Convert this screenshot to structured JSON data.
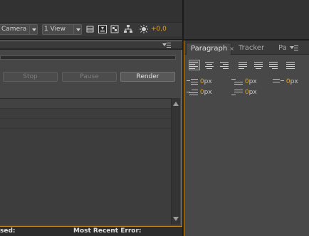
{
  "viewer_toolbar": {
    "view_dropdown": "Camera",
    "views_dropdown": "1 View",
    "exposure_value": "+0,0",
    "icons": [
      "grid-icon",
      "snapshot-icon",
      "transparency-grid-icon",
      "flowchart-icon",
      "exposure-icon"
    ]
  },
  "render_queue": {
    "buttons": {
      "stop": "Stop",
      "pause": "Pause",
      "render": "Render"
    },
    "status_bar": {
      "elapsed_label": "sed:",
      "error_label": "Most Recent Error:"
    }
  },
  "paragraph_panel": {
    "tabs": [
      {
        "label": "Paragraph",
        "close": "×"
      },
      {
        "label": "Tracker"
      },
      {
        "label": "Pa"
      }
    ],
    "alignment_icons": [
      "align-left-icon",
      "align-center-icon",
      "align-right-icon",
      "justify-left-icon",
      "justify-center-icon",
      "justify-right-icon",
      "justify-all-icon"
    ],
    "indents": {
      "indent_left": {
        "value": "0",
        "unit": "px"
      },
      "indent_right": {
        "value": "0",
        "unit": "px"
      },
      "first_line": {
        "value": "0",
        "unit": "px"
      },
      "space_before": {
        "value": "0",
        "unit": "px"
      },
      "space_after": {
        "value": "0",
        "unit": "px"
      }
    }
  },
  "colors": {
    "accent_orange": "#e0a224",
    "panel_border": "#c58a1c",
    "panel_bg": "#484848"
  }
}
